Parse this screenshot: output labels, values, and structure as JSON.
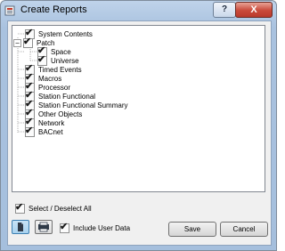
{
  "window": {
    "title": "Create Reports",
    "help_label": "?",
    "close_label": "X"
  },
  "tree": {
    "items": [
      {
        "label": "System Contents",
        "checked": true,
        "level": 0
      },
      {
        "label": "Patch",
        "checked": true,
        "level": 0,
        "expander": "−"
      },
      {
        "label": "Space",
        "checked": true,
        "level": 1
      },
      {
        "label": "Universe",
        "checked": true,
        "level": 1
      },
      {
        "label": "Timed Events",
        "checked": true,
        "level": 0
      },
      {
        "label": "Macros",
        "checked": true,
        "level": 0
      },
      {
        "label": "Processor",
        "checked": true,
        "level": 0
      },
      {
        "label": "Station Functional",
        "checked": true,
        "level": 0
      },
      {
        "label": "Station Functional Summary",
        "checked": true,
        "level": 0
      },
      {
        "label": "Other Objects",
        "checked": true,
        "level": 0
      },
      {
        "label": "Network",
        "checked": true,
        "level": 0
      },
      {
        "label": "BACnet",
        "checked": true,
        "level": 0
      }
    ]
  },
  "select_all": {
    "label": "Select / Deselect All",
    "checked": true
  },
  "include_user_data": {
    "label": "Include User Data",
    "checked": true
  },
  "check_mark": "✔",
  "buttons": {
    "save": "Save",
    "cancel": "Cancel"
  },
  "icons": {
    "document": "document-icon",
    "printer": "printer-icon"
  }
}
